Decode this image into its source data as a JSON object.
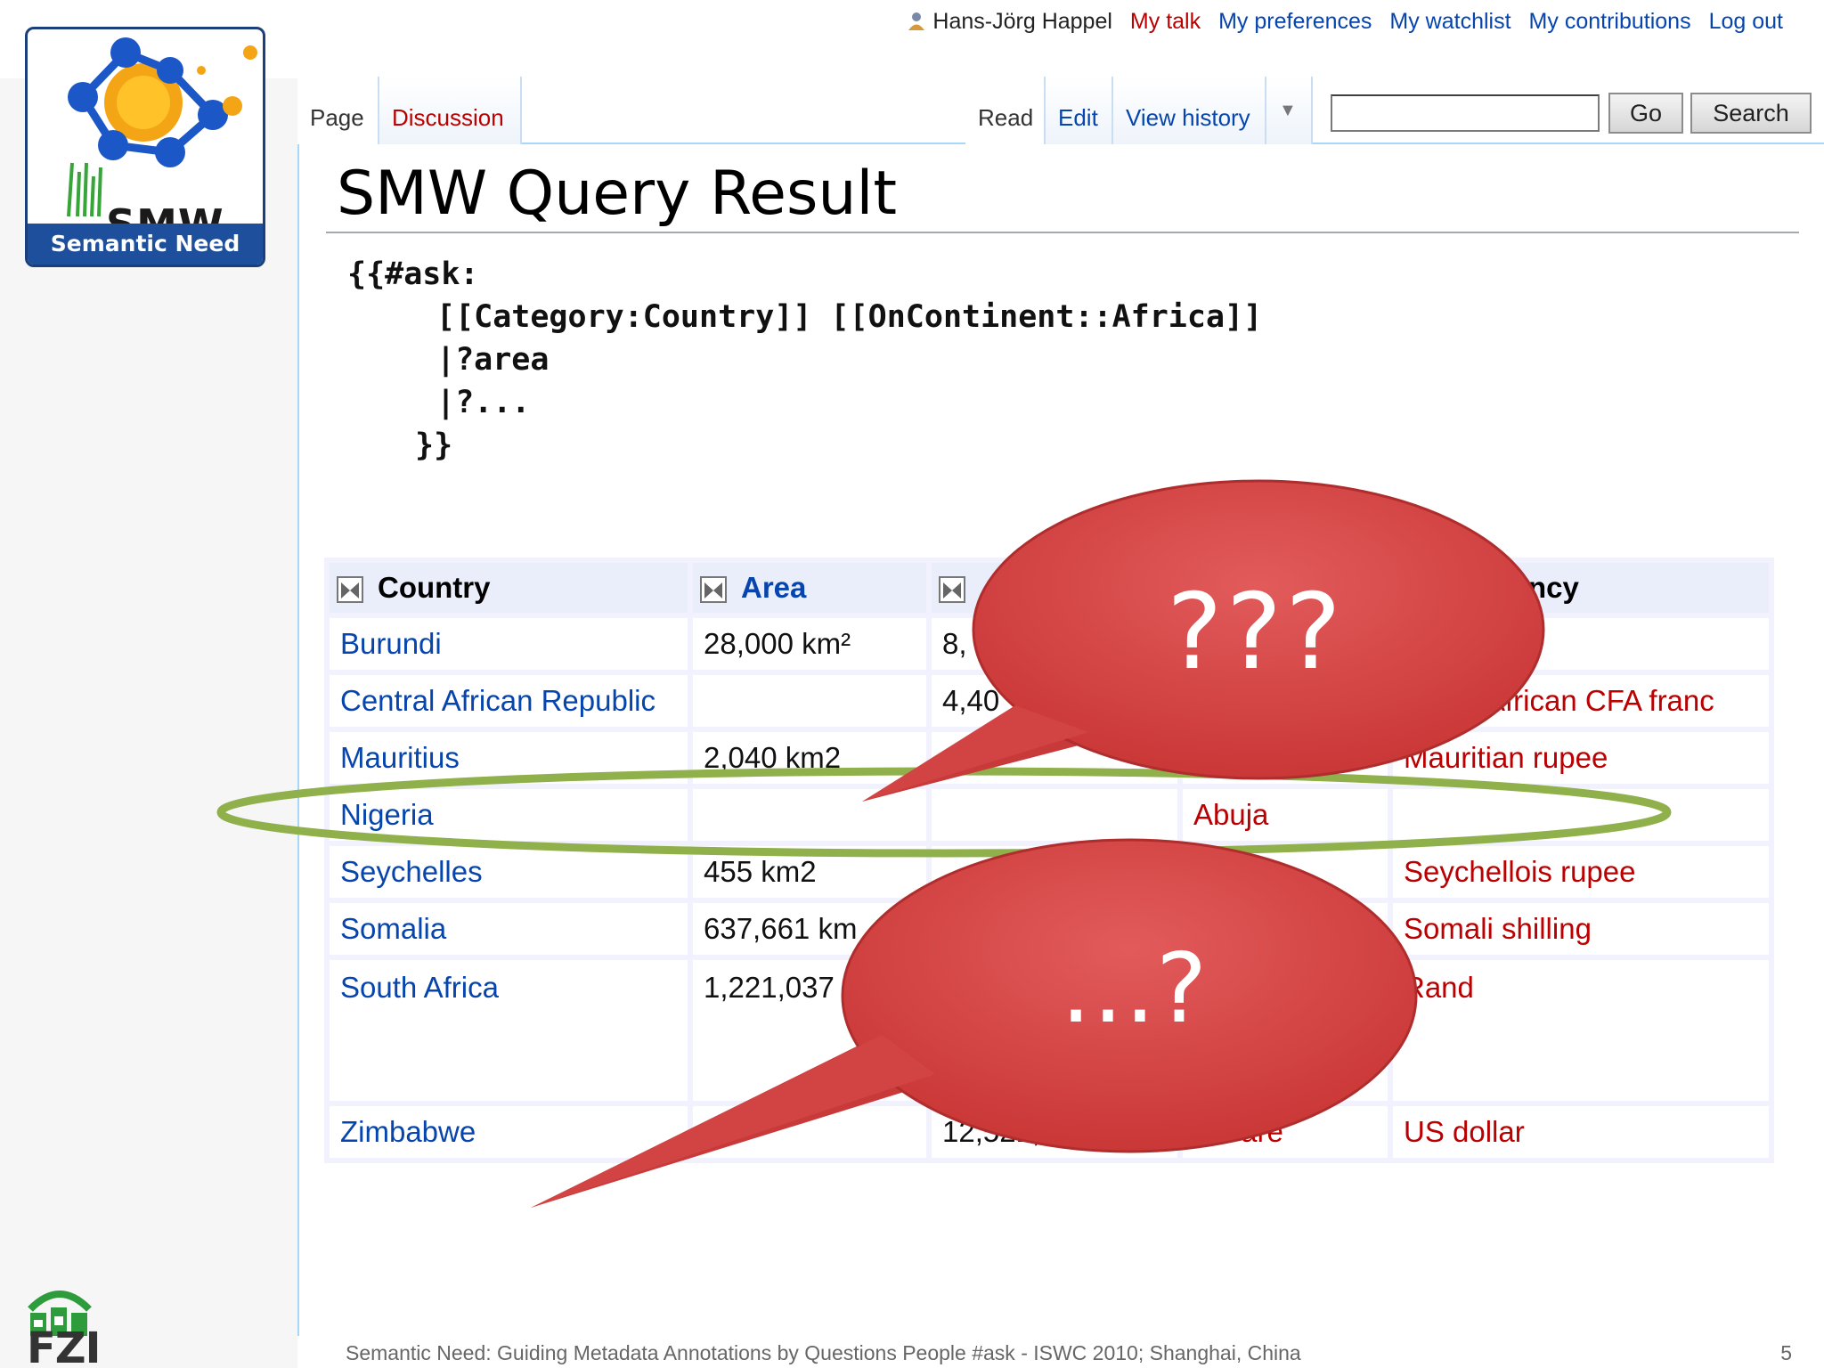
{
  "logo": {
    "smw_text": "SMW",
    "band_text": "Semantic Need"
  },
  "personal_tools": {
    "user": "Hans-Jörg Happel",
    "links": [
      "My talk",
      "My preferences",
      "My watchlist",
      "My contributions",
      "Log out"
    ]
  },
  "tabs": {
    "page": "Page",
    "discussion": "Discussion",
    "read": "Read",
    "edit": "Edit",
    "view_history": "View history"
  },
  "search": {
    "value": "",
    "go_label": "Go",
    "search_label": "Search"
  },
  "page_title": "SMW Query Result",
  "query_lines": [
    "{{#ask:",
    "[[Category:Country]] [[OnContinent::Africa]]",
    "|?area",
    "|?...",
    "}}"
  ],
  "table": {
    "headers": [
      "Country",
      "Area",
      "",
      "",
      "ncy"
    ],
    "rows": [
      {
        "country": "Burundi",
        "area": "28,000 km²",
        "population": "8,",
        "capital": "",
        "currency": ""
      },
      {
        "country": "Central African Republic",
        "area": "",
        "population": "4,40",
        "capital": "",
        "currency": "African CFA franc"
      },
      {
        "country": "Mauritius",
        "area": "2,040 km2",
        "population": "",
        "capital": "",
        "currency": "Mauritian rupee"
      },
      {
        "country": "Nigeria",
        "area": "",
        "population": "",
        "capital": "Abuja",
        "currency": ""
      },
      {
        "country": "Seychelles",
        "area": "455 km2",
        "population": "",
        "capital": "",
        "currency": "Seychellois rupee"
      },
      {
        "country": "Somalia",
        "area": "637,661 km",
        "population": "",
        "capital": "",
        "currency": "Somali shilling"
      },
      {
        "country": "South Africa",
        "area": "1,221,037",
        "population": "",
        "capital": "",
        "currency": "Rand"
      },
      {
        "country": "Zimbabwe",
        "area": "",
        "population": "12,521,000",
        "capital": "Harare",
        "currency": "US dollar"
      }
    ]
  },
  "callouts": {
    "first": "???",
    "second": "…?"
  },
  "colors": {
    "bubble": "#d84545",
    "highlight_ellipse": "#8fb04a",
    "link": "#0645ad",
    "redlink": "#ba0000"
  },
  "footer": {
    "text": "Semantic Need: Guiding Metadata Annotations by Questions People #ask - ISWC 2010; Shanghai, China",
    "page_number": "5",
    "org_logo": "FZI"
  }
}
